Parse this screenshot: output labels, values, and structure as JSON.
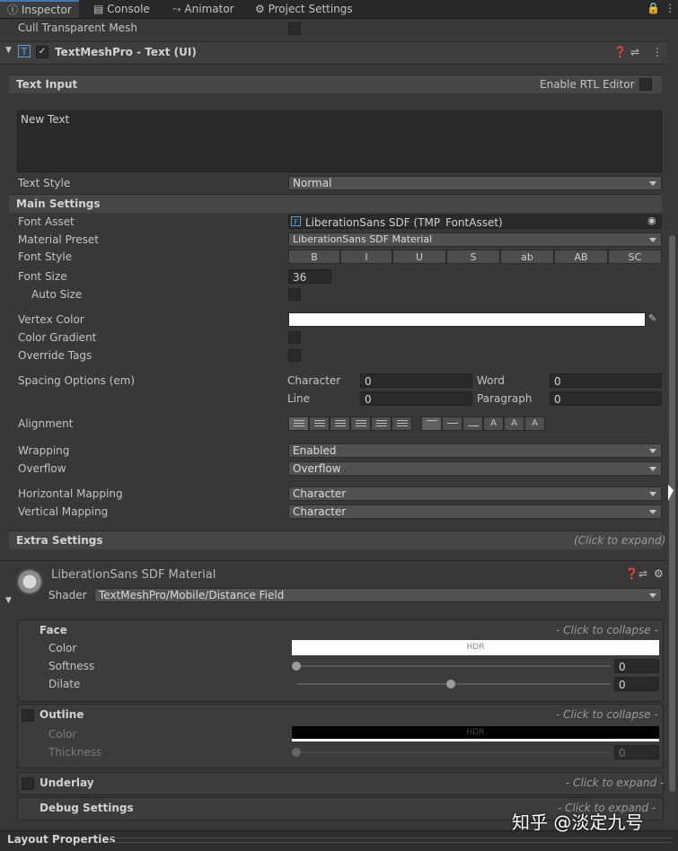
{
  "tabs": [
    "Inspector",
    "Console",
    "Animator",
    "Project Settings"
  ],
  "cull_label": "Cull Transparent Mesh",
  "component": {
    "title": "TextMeshPro - Text (UI)"
  },
  "text_input": {
    "header": "Text Input",
    "rtl_label": "Enable RTL Editor",
    "value": "New Text"
  },
  "text_style": {
    "label": "Text Style",
    "value": "Normal"
  },
  "main_settings": {
    "header": "Main Settings",
    "font_asset_label": "Font Asset",
    "font_asset_value": "LiberationSans SDF (TMP_FontAsset)",
    "material_preset_label": "Material Preset",
    "material_preset_value": "LiberationSans SDF Material",
    "font_style_label": "Font Style",
    "font_style_buttons": [
      "B",
      "I",
      "U",
      "S",
      "ab",
      "AB",
      "SC"
    ],
    "font_size_label": "Font Size",
    "font_size_value": "36",
    "auto_size_label": "Auto Size",
    "vertex_color_label": "Vertex Color",
    "color_gradient_label": "Color Gradient",
    "override_tags_label": "Override Tags",
    "spacing_label": "Spacing Options (em)",
    "character_label": "Character",
    "character_value": "0",
    "word_label": "Word",
    "word_value": "0",
    "line_label": "Line",
    "line_value": "0",
    "paragraph_label": "Paragraph",
    "paragraph_value": "0",
    "alignment_label": "Alignment",
    "wrapping_label": "Wrapping",
    "wrapping_value": "Enabled",
    "overflow_label": "Overflow",
    "overflow_value": "Overflow",
    "hmapping_label": "Horizontal Mapping",
    "hmapping_value": "Character",
    "vmapping_label": "Vertical Mapping",
    "vmapping_value": "Character"
  },
  "extra_settings": {
    "header": "Extra Settings",
    "hint": "(Click to expand)"
  },
  "material": {
    "name": "LiberationSans SDF Material",
    "shader_label": "Shader",
    "shader_value": "TextMeshPro/Mobile/Distance Field",
    "face": {
      "header": "Face",
      "hint": "- Click to collapse -",
      "color_label": "Color",
      "hdr": "HDR",
      "softness_label": "Softness",
      "softness_value": "0",
      "dilate_label": "Dilate",
      "dilate_value": "0"
    },
    "outline": {
      "header": "Outline",
      "hint": "- Click to collapse -",
      "color_label": "Color",
      "hdr": "HDR",
      "thickness_label": "Thickness",
      "thickness_value": "0"
    },
    "underlay": {
      "header": "Underlay",
      "hint": "- Click to expand -"
    },
    "debug": {
      "header": "Debug Settings",
      "hint": "- Click to expand -"
    }
  },
  "layout_properties": "Layout Properties",
  "watermark": "知乎 @淡定九号",
  "colors": {
    "accent": "#3a79bb",
    "panel": "#383838",
    "section": "#464646"
  }
}
